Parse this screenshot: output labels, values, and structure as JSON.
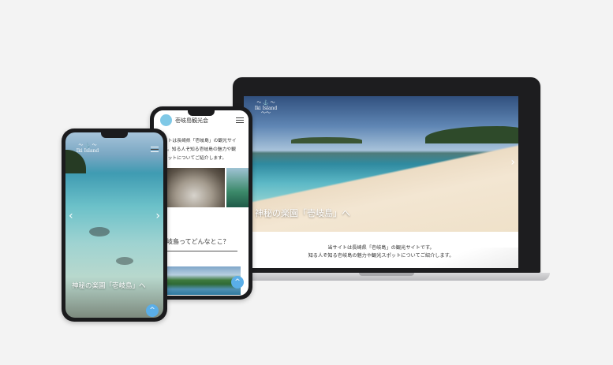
{
  "laptop": {
    "hero_caption": "神秘の楽園「壱岐島」へ",
    "intro_line1": "当サイトは長崎県「壱岐島」の観光サイトです。",
    "intro_line2": "知る人ぞ知る壱岐島の魅力や観光スポットについてご紹介します。"
  },
  "phone_back": {
    "site_title": "壱岐島観光会",
    "intro_text_1": "サイトは長崎県「壱岐島」の観光サイ",
    "intro_text_2": "です。知る人ぞ知る壱岐島の魅力や観",
    "intro_text_3": "スポットについてご紹介します。",
    "heading": "壱岐島ってどんなとこ？",
    "up_button": "^"
  },
  "phone_front": {
    "hero_caption": "神秘の楽園「壱岐島」へ",
    "up_button": "^"
  },
  "colors": {
    "background": "#f3f3f3",
    "device_frame": "#1b1b1d",
    "accent_blue": "#5aaee8"
  }
}
